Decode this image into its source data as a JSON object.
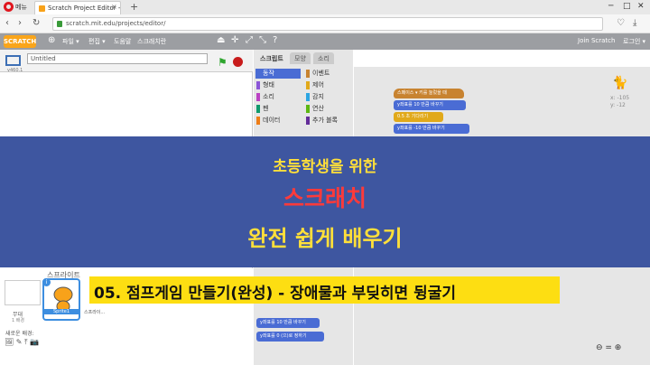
{
  "browser": {
    "menu_label": "메뉴",
    "tab_title": "Scratch Project Editor - I",
    "tab_close": "×",
    "tab_new": "+",
    "url": "scratch.mit.edu/projects/editor/"
  },
  "scratch_menu": {
    "logo": "SCRATCH",
    "file": "파일 ▾",
    "edit": "편집 ▾",
    "tips": "도움말",
    "about": "스크래치란",
    "join": "Join Scratch",
    "login": "로그인 ▾"
  },
  "stage": {
    "project_title": "Untitled",
    "version": "v460.1"
  },
  "tabs": [
    "스크립트",
    "모양",
    "소리"
  ],
  "categories": [
    {
      "label": "동작",
      "color": "#4a6cd4"
    },
    {
      "label": "형태",
      "color": "#8a55d7"
    },
    {
      "label": "소리",
      "color": "#bb42c3"
    },
    {
      "label": "펜",
      "color": "#0e9a6c"
    },
    {
      "label": "데이터",
      "color": "#ee7d16"
    },
    {
      "label": "이벤트",
      "color": "#c88330"
    },
    {
      "label": "제어",
      "color": "#e1a91a"
    },
    {
      "label": "감지",
      "color": "#2ca5e2"
    },
    {
      "label": "연산",
      "color": "#5cb712"
    },
    {
      "label": "추가 블록",
      "color": "#632d99"
    }
  ],
  "script_blocks": [
    {
      "text": "스페이스 ▾ 키를 눌렀을 때"
    },
    {
      "text": "y좌표를 10 만큼 바꾸기"
    },
    {
      "text": "0.5 초 기다리기"
    },
    {
      "text": "y좌표를 -10 만큼 바꾸기"
    }
  ],
  "palette_blocks": [
    {
      "text": "y좌표를 10 만큼 바꾸기"
    },
    {
      "text": "y좌표를 0 (으)로 정하기"
    }
  ],
  "sprite_xy": [
    "x: -105",
    "y: -12"
  ],
  "sprite_panel": {
    "header": "스프라이트",
    "stage_label": "무대",
    "bg_count": "1 배경",
    "new_bg": "새로운 배경:",
    "sprite_name": "Sprite1",
    "sprite_name2": "스프라이..."
  },
  "zoom": "⊖ = ⊕",
  "overlay": {
    "line1": "초등학생을 위한",
    "line2": "스크래치",
    "line3": "완전 쉽게 배우기",
    "subtitle": "05. 점프게임 만들기(완성) - 장애물과 부딪히면 뒹굴기"
  }
}
